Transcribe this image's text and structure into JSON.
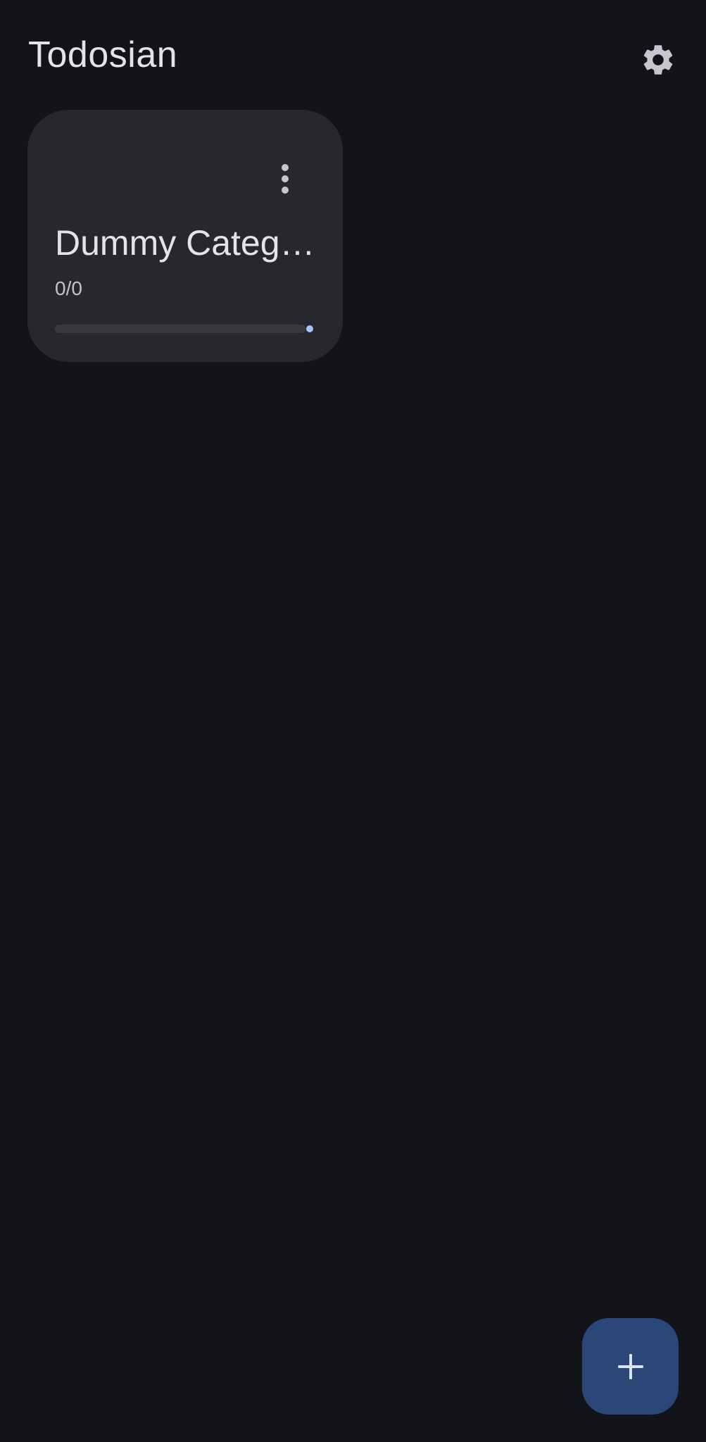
{
  "app_bar": {
    "title": "Todosian",
    "settings_icon": "gear-icon"
  },
  "categories": [
    {
      "title": "Dummy Categ…",
      "count_text": "0/0",
      "progress": 0,
      "menu_icon": "more-vertical-icon"
    }
  ],
  "fab": {
    "icon": "plus-icon"
  },
  "colors": {
    "background": "#13141a",
    "card": "#27282e",
    "text_primary": "#e3e3ea",
    "text_secondary": "#c3c3cc",
    "progress_track": "#393a41",
    "progress_indicator": "#a8c4ff",
    "fab": "#2b4778"
  }
}
